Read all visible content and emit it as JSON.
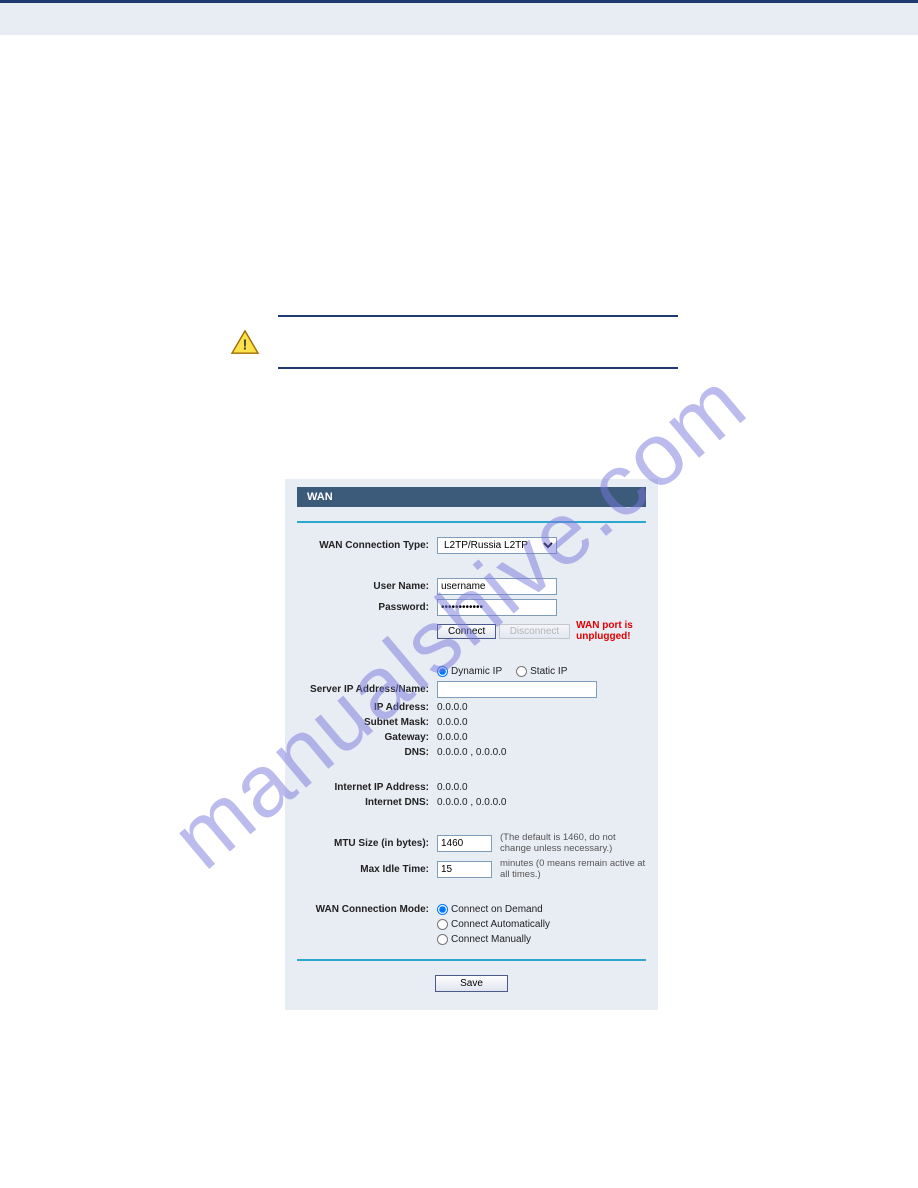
{
  "watermark": "manualshive.com",
  "panel": {
    "title": "WAN",
    "labels": {
      "wan_conn_type": "WAN Connection Type:",
      "user_name": "User Name:",
      "password": "Password:",
      "server_ip": "Server IP Address/Name:",
      "ip_address": "IP Address:",
      "subnet_mask": "Subnet Mask:",
      "gateway": "Gateway:",
      "dns": "DNS:",
      "internet_ip": "Internet IP Address:",
      "internet_dns": "Internet DNS:",
      "mtu": "MTU Size (in bytes):",
      "max_idle": "Max Idle Time:",
      "wan_mode": "WAN Connection Mode:"
    },
    "values": {
      "wan_conn_type": "L2TP/Russia L2TP",
      "user_name": "username",
      "password": "••••••••••••",
      "server_ip": "",
      "ip_address": "0.0.0.0",
      "subnet_mask": "0.0.0.0",
      "gateway": "0.0.0.0",
      "dns": "0.0.0.0 , 0.0.0.0",
      "internet_ip": "0.0.0.0",
      "internet_dns": "0.0.0.0 , 0.0.0.0",
      "mtu": "1460",
      "max_idle": "15"
    },
    "buttons": {
      "connect": "Connect",
      "disconnect": "Disconnect",
      "save": "Save"
    },
    "status_text": "WAN port is unplugged!",
    "radios": {
      "dynamic_ip": "Dynamic IP",
      "static_ip": "Static IP",
      "connect_demand": "Connect on Demand",
      "connect_auto": "Connect Automatically",
      "connect_manual": "Connect Manually"
    },
    "hints": {
      "mtu": "(The default is 1460, do not change unless necessary.)",
      "max_idle": "minutes (0 means remain active at all times.)"
    }
  }
}
